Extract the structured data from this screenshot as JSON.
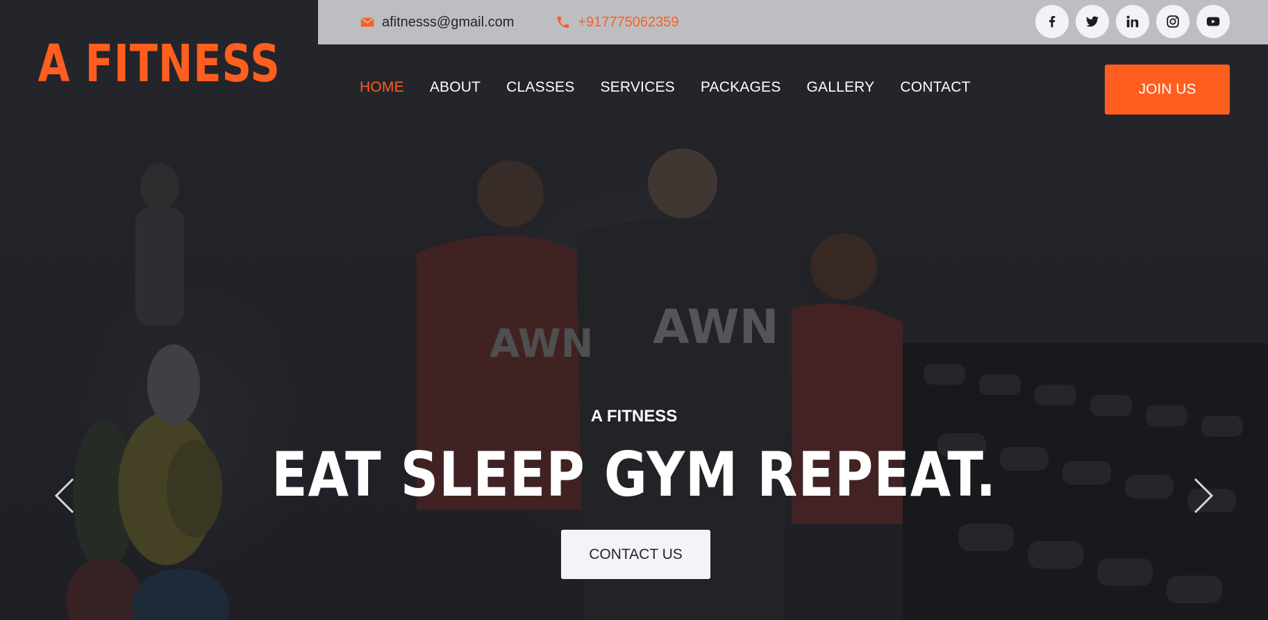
{
  "brand": {
    "logo_text": "A FITNESS",
    "accent_color": "#ff5e1f"
  },
  "topbar": {
    "email": {
      "icon": "envelope-icon",
      "text": "afitnesss@gmail.com"
    },
    "phone": {
      "icon": "phone-icon",
      "text": "+917775062359"
    },
    "socials": [
      "facebook-icon",
      "twitter-icon",
      "linkedin-icon",
      "instagram-icon",
      "youtube-icon"
    ]
  },
  "nav": {
    "items": [
      {
        "label": "HOME",
        "active": true
      },
      {
        "label": "ABOUT",
        "active": false
      },
      {
        "label": "CLASSES",
        "active": false
      },
      {
        "label": "SERVICES",
        "active": false
      },
      {
        "label": "PACKAGES",
        "active": false
      },
      {
        "label": "GALLERY",
        "active": false
      },
      {
        "label": "CONTACT",
        "active": false
      }
    ],
    "join_label": "JOIN US"
  },
  "hero": {
    "subtitle": "A FITNESS",
    "title": "EAT SLEEP GYM REPEAT.",
    "cta_label": "CONTACT US"
  }
}
